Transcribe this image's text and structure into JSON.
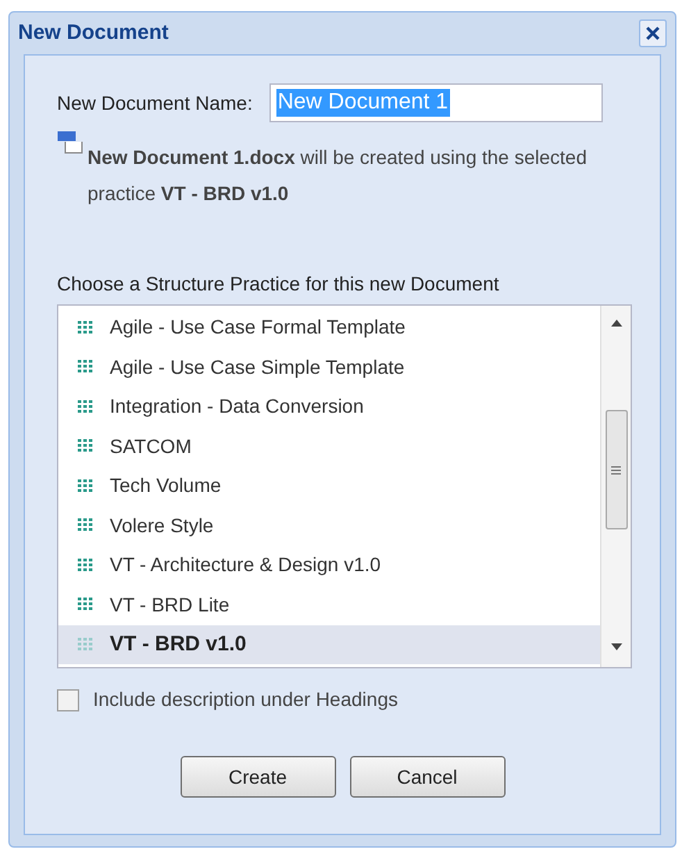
{
  "window": {
    "title": "New Document"
  },
  "name_field": {
    "label": "New Document Name:",
    "value": "New Document 1"
  },
  "info": {
    "text": "**New Document 1.docx** will be created using the selected practice **VT - BRD v1.0**"
  },
  "practices": {
    "label": "Choose a Structure Practice for this new Document",
    "items": [
      {
        "label": "Agile - Use Case Formal Template",
        "selected": false
      },
      {
        "label": "Agile - Use Case Simple Template",
        "selected": false
      },
      {
        "label": "Integration - Data Conversion",
        "selected": false
      },
      {
        "label": "SATCOM",
        "selected": false
      },
      {
        "label": "Tech Volume",
        "selected": false
      },
      {
        "label": "Volere Style",
        "selected": false
      },
      {
        "label": "VT - Architecture & Design v1.0",
        "selected": false
      },
      {
        "label": "VT - BRD Lite",
        "selected": false
      },
      {
        "label": "VT - BRD v1.0",
        "selected": true
      }
    ]
  },
  "include_description": {
    "label": "Include description under Headings",
    "checked": false
  },
  "buttons": [
    "Create",
    "Cancel"
  ]
}
